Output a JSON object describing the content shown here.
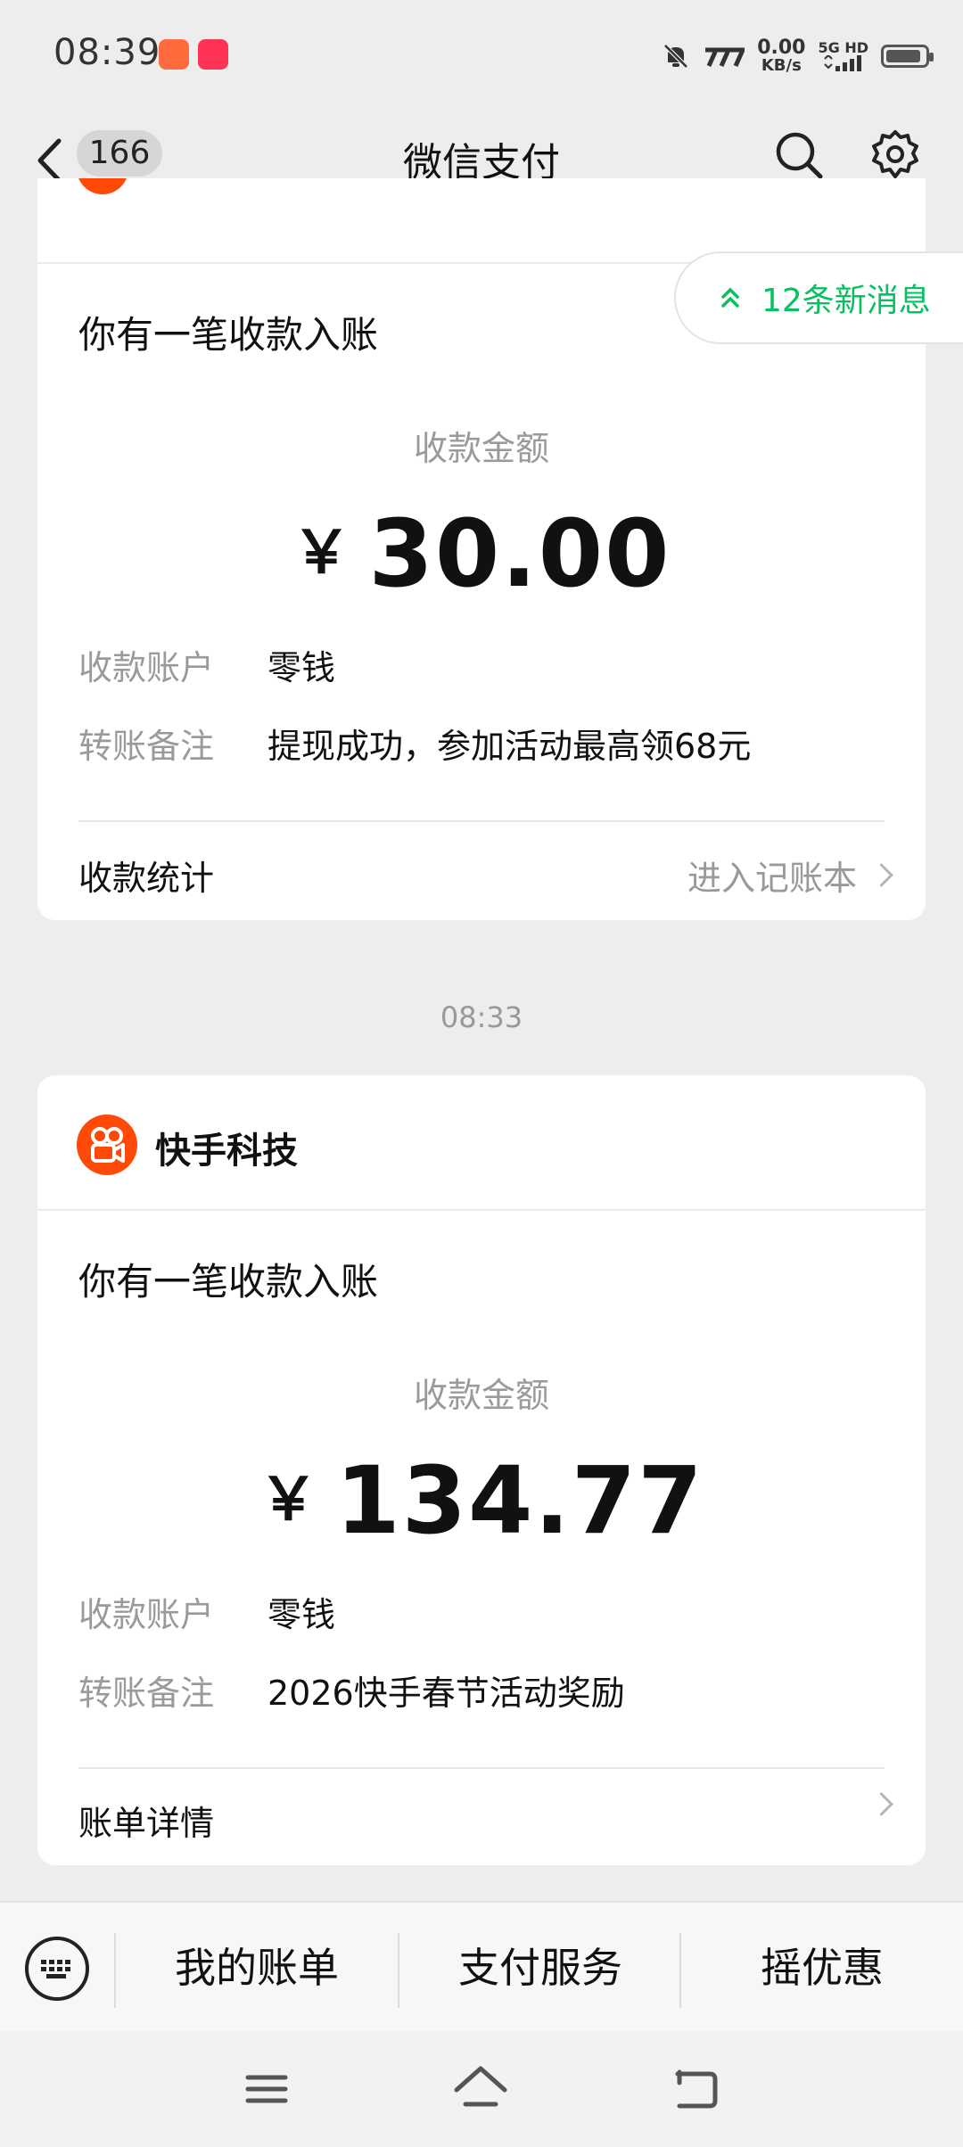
{
  "status_bar": {
    "time": "08:39",
    "net_speed_value": "0.00",
    "net_speed_unit": "KB/s",
    "net_type_top": "5G HD",
    "battery_level": 0.85
  },
  "nav": {
    "unread_count": "166",
    "title": "微信支付"
  },
  "new_messages": {
    "label": "12条新消息"
  },
  "card1": {
    "headline": "你有一笔收款入账",
    "amount_label": "收款金额",
    "currency": "￥",
    "amount": "30.00",
    "rows": [
      {
        "key": "收款账户",
        "value": "零钱"
      },
      {
        "key": "转账备注",
        "value": "提现成功，参加活动最高领68元"
      }
    ],
    "footer_left": "收款统计",
    "footer_right": "进入记账本"
  },
  "time_separator": "08:33",
  "card2": {
    "merchant": "快手科技",
    "headline": "你有一笔收款入账",
    "amount_label": "收款金额",
    "currency": "￥",
    "amount": "134.77",
    "rows": [
      {
        "key": "收款账户",
        "value": "零钱"
      },
      {
        "key": "转账备注",
        "value": "2026快手春节活动奖励"
      }
    ],
    "footer_left": "账单详情"
  },
  "bottom_menu": {
    "items": [
      "我的账单",
      "支付服务",
      "摇优惠"
    ]
  },
  "colors": {
    "accent_green": "#07c160",
    "kuaishou_orange": "#ff4906",
    "background": "#ededed"
  },
  "icons": [
    "back-chevron-icon",
    "search-icon",
    "gear-icon",
    "double-chevron-up-icon",
    "kuaishou-logo-icon",
    "keyboard-icon",
    "menu-lines-icon",
    "home-icon",
    "back-arrow-icon"
  ]
}
